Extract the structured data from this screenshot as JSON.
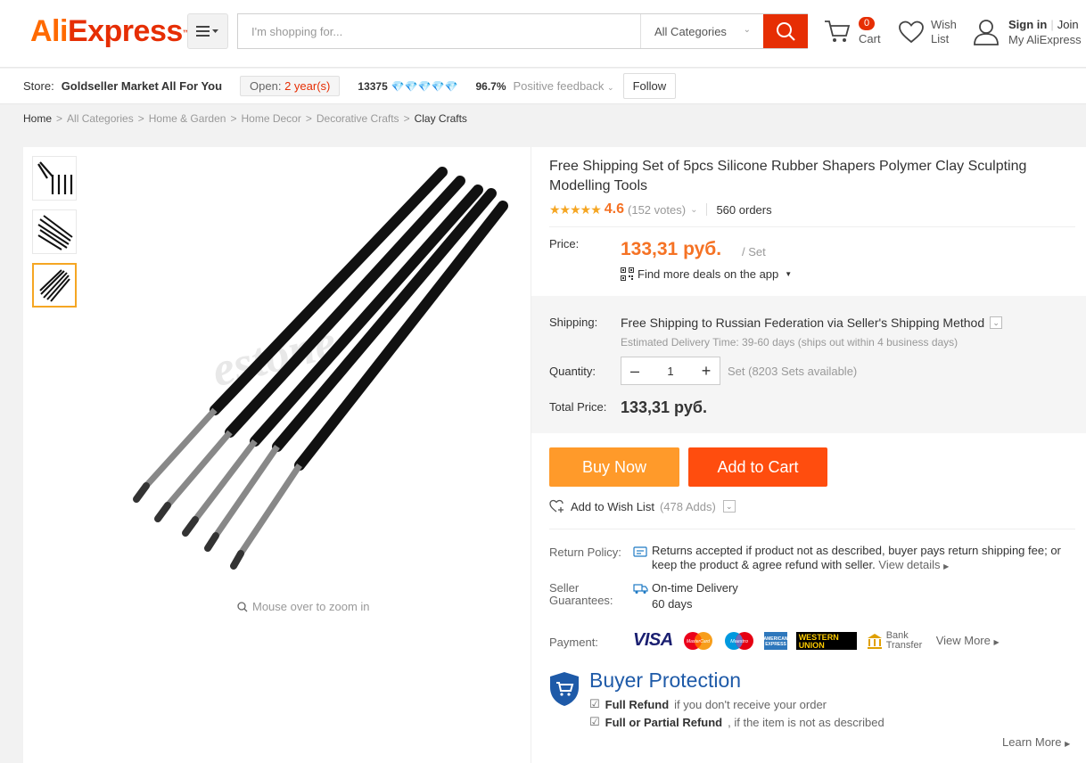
{
  "header": {
    "logo_part1": "Ali",
    "logo_part2": "Express",
    "logo_tm": "™",
    "search_placeholder": "I'm shopping for...",
    "category": "All Categories",
    "cart_count": "0",
    "cart_label": "Cart",
    "wish_label": "Wish List",
    "sign_in": "Sign in",
    "join": "Join",
    "my_account": "My AliExpress"
  },
  "store": {
    "label": "Store:",
    "name": "Goldseller Market All For You",
    "open_label": "Open:",
    "open_years": "2 year(s)",
    "score": "13375",
    "diamonds": "💎💎💎💎💎",
    "feedback_pct": "96.7%",
    "feedback_label": "Positive feedback",
    "follow": "Follow"
  },
  "breadcrumb": [
    "Home",
    "All Categories",
    "Home & Garden",
    "Home Decor",
    "Decorative Crafts",
    "Clay Crafts"
  ],
  "gallery": {
    "zoom_hint": "Mouse over to zoom in",
    "watermark": "estone"
  },
  "product": {
    "title": "Free Shipping Set of 5pcs Silicone Rubber Shapers Polymer Clay Sculpting Modelling Tools",
    "stars": "★★★★★",
    "rating": "4.6",
    "votes": "(152 votes)",
    "orders": "560 orders",
    "price_label": "Price:",
    "price": "133,31 руб.",
    "price_unit": "/ Set",
    "app_deals": "Find more deals on the app",
    "shipping_label": "Shipping:",
    "shipping_free": "Free Shipping",
    "shipping_rest": " to Russian Federation via Seller's Shipping Method",
    "shipping_est": "Estimated Delivery Time: 39-60 days (ships out within 4 business days)",
    "quantity_label": "Quantity:",
    "quantity": "1",
    "qty_available": "Set (8203 Sets available)",
    "total_label": "Total Price:",
    "total": "133,31 руб.",
    "buy_now": "Buy Now",
    "add_to_cart": "Add to Cart",
    "wishlist": "Add to Wish List",
    "wishlist_adds": "(478 Adds)"
  },
  "policy": {
    "return_label": "Return Policy:",
    "return_text": "Returns accepted if product not as described, buyer pays return shipping fee; or keep the product & agree refund with seller.",
    "view_details": "View details",
    "seller_label": "Seller Guarantees:",
    "on_time": "On-time Delivery",
    "days": "60 days",
    "payment_label": "Payment:",
    "visa": "VISA",
    "mastercard": "MasterCard",
    "maestro": "Maestro",
    "amex": "AMEX",
    "western_union": "WESTERN UNION",
    "bank_transfer": "Bank Transfer",
    "view_more": "View More"
  },
  "protection": {
    "title": "Buyer Protection",
    "row1_bold": "Full Refund",
    "row1_rest": "if you don't receive your order",
    "row2_bold": "Full or Partial Refund",
    "row2_rest": ", if the item is not as described",
    "learn_more": "Learn More"
  },
  "colors": {
    "brand_orange": "#ff6a00",
    "brand_red": "#e62e04",
    "buy_now": "#ff9a2a",
    "add_to_cart": "#ff4d0e",
    "price": "#f57224",
    "protection_blue": "#1e5aa8"
  }
}
